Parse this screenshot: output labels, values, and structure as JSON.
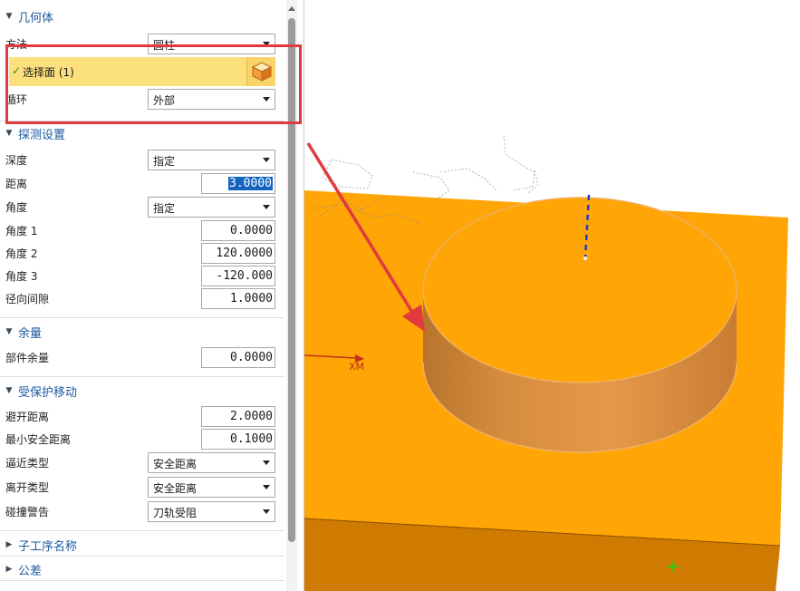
{
  "panel": {
    "sections": {
      "geometry": "几何体",
      "probe_settings": "探测设置",
      "allowance": "余量",
      "protected_move": "受保护移动",
      "sub_op_name": "子工序名称",
      "tolerance": "公差"
    },
    "geometry": {
      "method_label": "方法",
      "method_value": "圆柱",
      "select_face_label": "选择面 (1)",
      "loop_label": "循环",
      "loop_value": "外部"
    },
    "probe": {
      "depth_label": "深度",
      "depth_value": "指定",
      "distance_label": "距离",
      "distance_value": "3.0000",
      "angle_label": "角度",
      "angle_value": "指定",
      "angle1_label": "角度 1",
      "angle1_value": "0.0000",
      "angle2_label": "角度 2",
      "angle2_value": "120.0000",
      "angle3_label": "角度 3",
      "angle3_value": "-120.000",
      "radial_clearance_label": "径向间隙",
      "radial_clearance_value": "1.0000"
    },
    "allowance": {
      "part_allowance_label": "部件余量",
      "part_allowance_value": "0.0000"
    },
    "protected": {
      "clearance_label": "避开距离",
      "clearance_value": "2.0000",
      "min_safe_label": "最小安全距离",
      "min_safe_value": "0.1000",
      "approach_label": "逼近类型",
      "approach_value": "安全距离",
      "depart_label": "离开类型",
      "depart_value": "安全距离",
      "collision_label": "碰撞警告",
      "collision_value": "刀轨受阻"
    }
  },
  "viewport": {
    "axis_label": "XM",
    "colors": {
      "top_face": "#ffa506",
      "front_face": "#cf7a00",
      "annotation": "#e0393e"
    }
  }
}
